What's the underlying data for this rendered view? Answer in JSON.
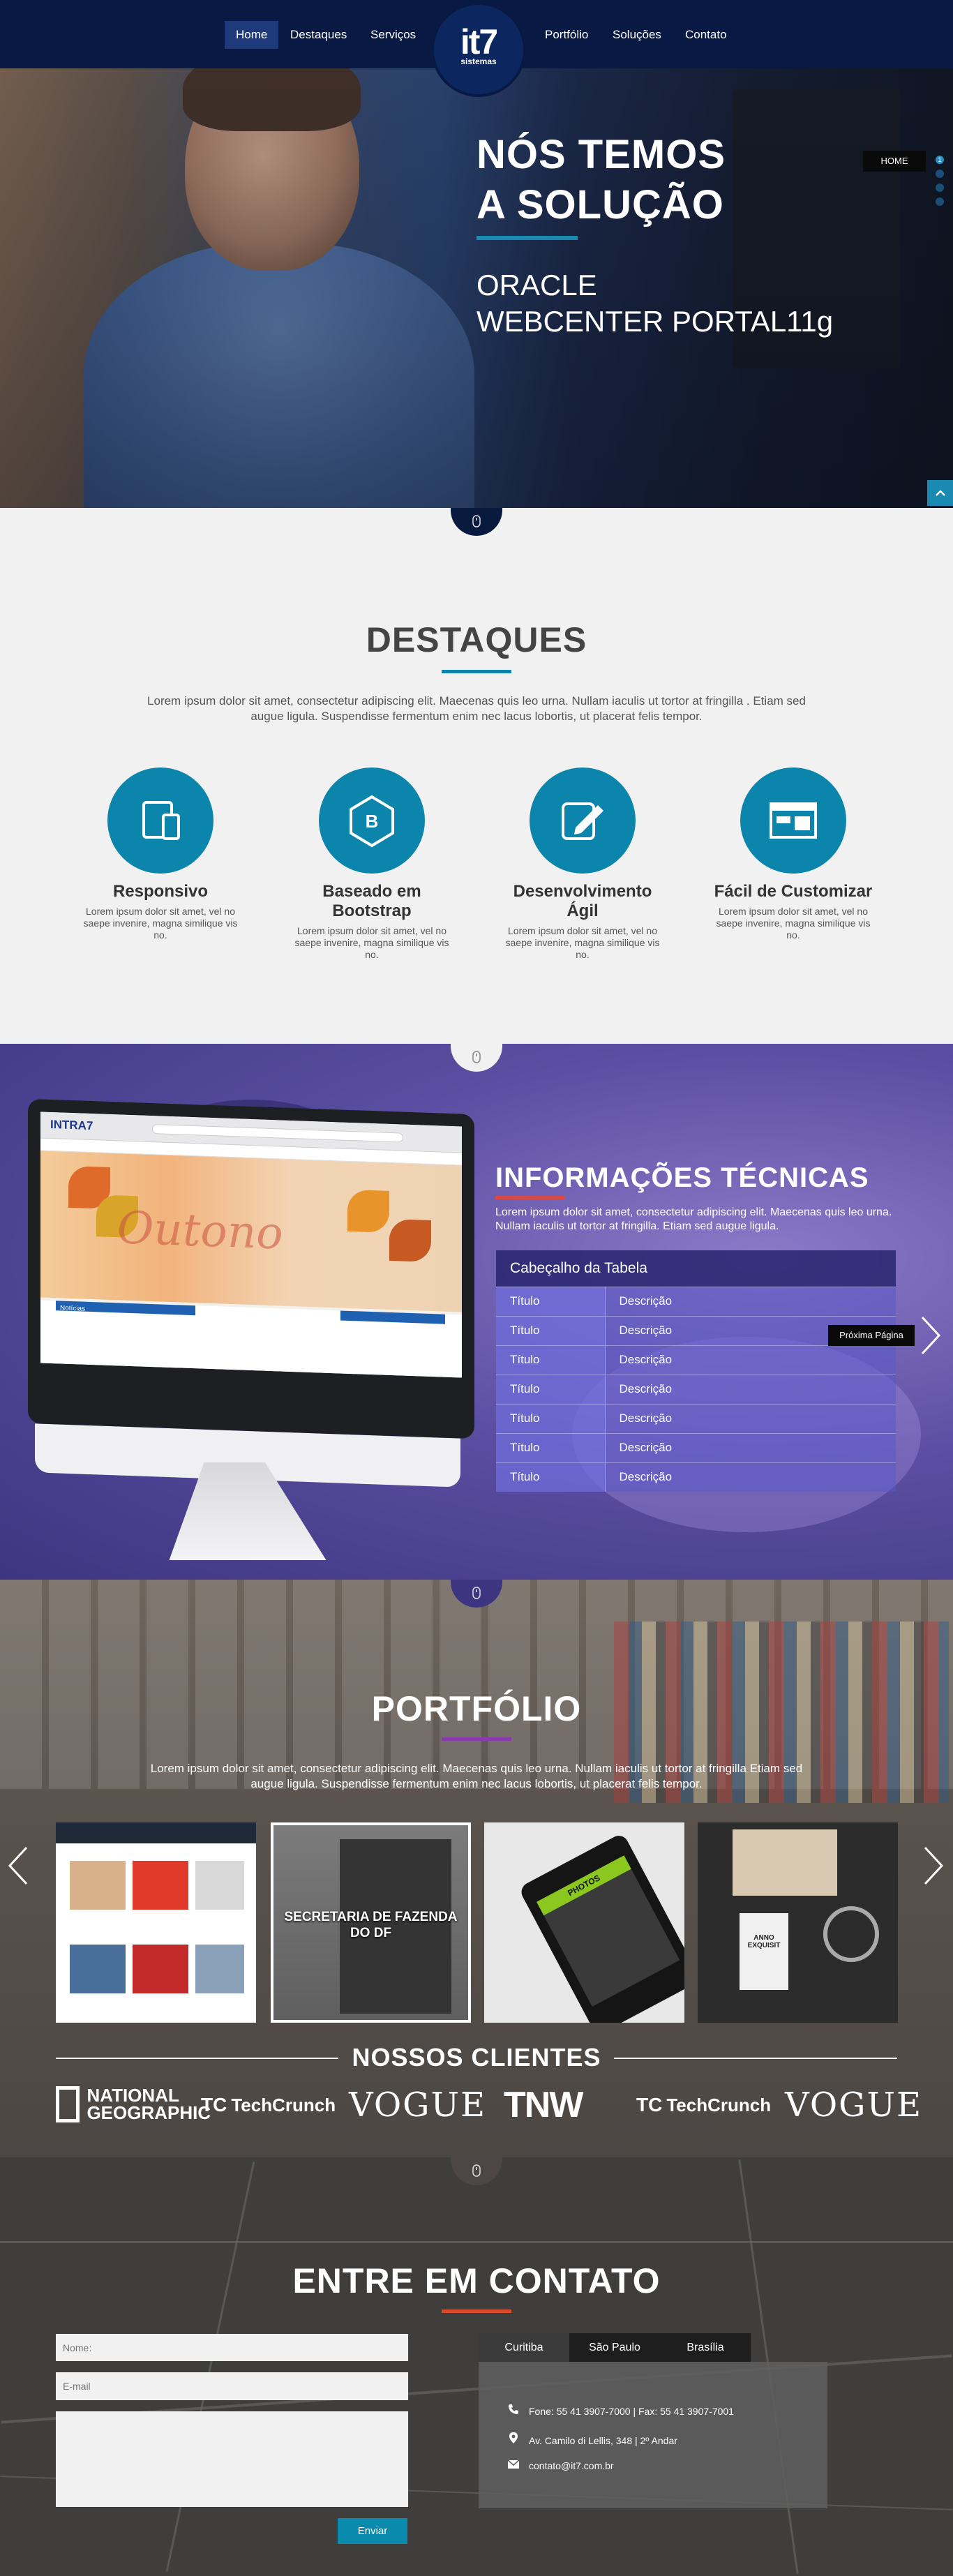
{
  "nav": {
    "links": [
      "Home",
      "Destaques",
      "Serviços",
      "Portfólio",
      "Soluções",
      "Contato"
    ],
    "logo_big": "it7",
    "logo_small": "sistemas"
  },
  "hero": {
    "title_line1": "NÓS TEMOS",
    "title_line2": "A SOLUÇÃO",
    "subtitle_line1": "ORACLE",
    "subtitle_line2": "WEBCENTER PORTAL11g",
    "badge": "HOME",
    "slide_number": "1"
  },
  "destaques": {
    "title": "DESTAQUES",
    "text": "Lorem ipsum dolor sit amet, consectetur adipiscing elit. Maecenas quis leo urna. Nullam iaculis ut tortor at fringilla . Etiam sed augue ligula. Suspendisse fermentum enim nec lacus lobortis, ut placerat felis tempor.",
    "features": [
      {
        "title": "Responsivo",
        "text": "Lorem ipsum dolor sit amet, vel no saepe invenire, magna similique vis no."
      },
      {
        "title": "Baseado em Bootstrap",
        "text": "Lorem ipsum dolor sit amet, vel no saepe invenire, magna similique vis no."
      },
      {
        "title": "Desenvolvimento Ágil",
        "text": "Lorem ipsum dolor sit amet, vel no saepe invenire, magna similique vis no."
      },
      {
        "title": "Fácil de Customizar",
        "text": "Lorem ipsum dolor sit amet, vel no saepe invenire, magna similique vis no."
      }
    ]
  },
  "info": {
    "title": "INFORMAÇÕES TÉCNICAS",
    "text": "Lorem ipsum dolor sit amet, consectetur adipiscing elit. Maecenas quis leo urna. Nullam iaculis ut tortor at fringilla. Etiam sed augue ligula.",
    "table_header": "Cabeçalho da Tabela",
    "rows": [
      {
        "c1": "Título",
        "c2": "Descrição"
      },
      {
        "c1": "Título",
        "c2": "Descrição"
      },
      {
        "c1": "Título",
        "c2": "Descrição"
      },
      {
        "c1": "Título",
        "c2": "Descrição"
      },
      {
        "c1": "Título",
        "c2": "Descrição"
      },
      {
        "c1": "Título",
        "c2": "Descrição"
      },
      {
        "c1": "Título",
        "c2": "Descrição"
      }
    ],
    "next_page": "Próxima Página",
    "monitor": {
      "logo": "INTRA7",
      "banner_text": "Outono",
      "news_label": "Notícias"
    }
  },
  "portfolio": {
    "title": "PORTFÓLIO",
    "text": "Lorem ipsum dolor sit amet, consectetur adipiscing elit. Maecenas quis leo urna. Nullam iaculis ut tortor at fringilla Etiam sed augue ligula. Suspendisse fermentum enim nec lacus lobortis, ut placerat felis tempor.",
    "caption": "SECRETARIA DE FAZENDA DO DF",
    "phone_label": "PHOTOS",
    "card_label": "ANNO EXQUISIT",
    "clients_title": "NOSSOS CLIENTES",
    "clients": {
      "natgeo": "NATIONAL GEOGRAPHIC",
      "techcrunch": "TechCrunch",
      "tc_mark": "TC",
      "vogue": "VOGUE",
      "tnw": "TNW"
    }
  },
  "contato": {
    "title": "ENTRE EM CONTATO",
    "name_placeholder": "Nome:",
    "email_placeholder": "E-mail",
    "send_label": "Enviar",
    "tabs": [
      "Curitiba",
      "São Paulo",
      "Brasília"
    ],
    "phone": "Fone: 55 41 3907-7000 | Fax:   55 41 3907-7001",
    "address": "Av. Camilo di Lellis, 348  |  2º Andar",
    "email": "contato@it7.com.br"
  },
  "colors": {
    "accent": "#0b85ab",
    "nav_bg": "#081a44",
    "red_rule": "#d84a4a",
    "purple_rule": "#8a3ab0"
  }
}
